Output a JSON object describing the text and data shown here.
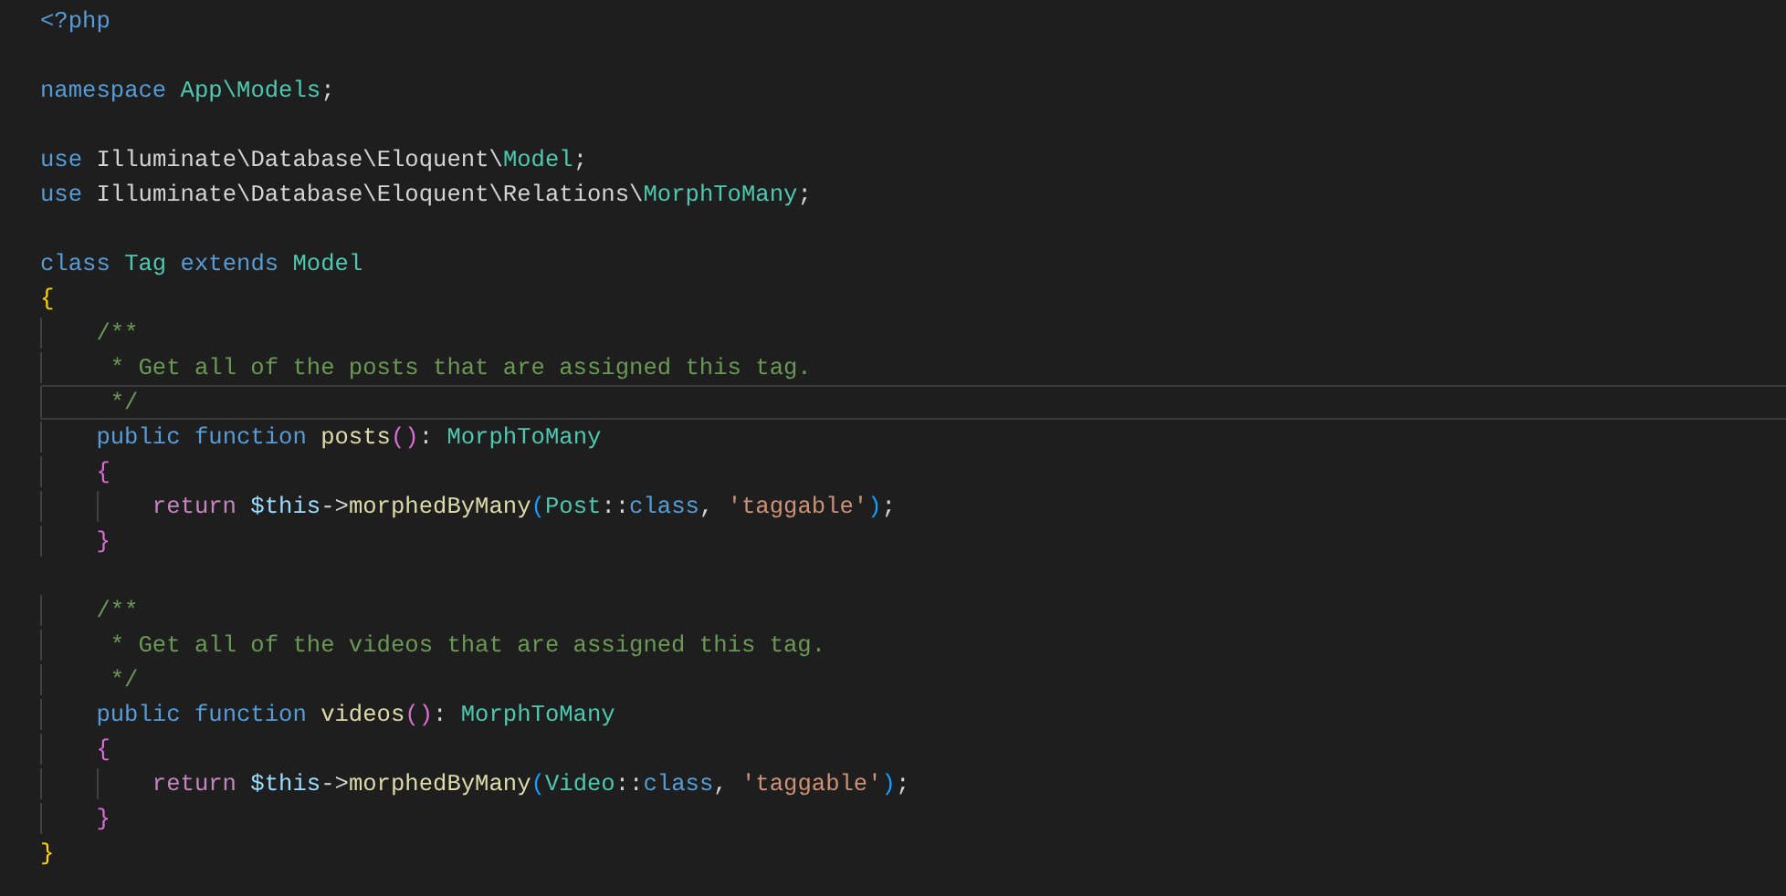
{
  "editor": {
    "lines": [
      {
        "current": false,
        "tokens": [
          {
            "kind": "keyword",
            "text": "<?php"
          }
        ]
      },
      {
        "current": false
      },
      {
        "current": false,
        "tokens": [
          {
            "kind": "keyword",
            "text": "namespace "
          },
          {
            "kind": "type",
            "text": "App\\Models"
          },
          {
            "kind": "plain",
            "text": ";"
          }
        ]
      },
      {
        "current": false
      },
      {
        "current": false,
        "tokens": [
          {
            "kind": "keyword",
            "text": "use"
          },
          {
            "kind": "plain",
            "text": " Illuminate\\Database\\Eloquent\\"
          },
          {
            "kind": "type",
            "text": "Model"
          },
          {
            "kind": "plain",
            "text": ";"
          }
        ]
      },
      {
        "current": false,
        "tokens": [
          {
            "kind": "keyword",
            "text": "use"
          },
          {
            "kind": "plain",
            "text": " Illuminate\\Database\\Eloquent\\Relations\\"
          },
          {
            "kind": "type",
            "text": "MorphToMany"
          },
          {
            "kind": "plain",
            "text": ";"
          }
        ]
      },
      {
        "current": false
      },
      {
        "current": false,
        "tokens": [
          {
            "kind": "keyword",
            "text": "class "
          },
          {
            "kind": "type",
            "text": "Tag "
          },
          {
            "kind": "keyword",
            "text": "extends "
          },
          {
            "kind": "type",
            "text": "Model"
          }
        ]
      },
      {
        "current": false,
        "tokens": [
          {
            "kind": "bracket1",
            "text": "{"
          }
        ]
      },
      {
        "current": false,
        "tokens": [
          {
            "kind": "comment",
            "text": "    /**"
          }
        ]
      },
      {
        "current": false,
        "tokens": [
          {
            "kind": "comment",
            "text": "     * Get all of the posts that are assigned this tag."
          }
        ]
      },
      {
        "current": true,
        "tokens": [
          {
            "kind": "comment",
            "text": "     */"
          }
        ]
      },
      {
        "current": false,
        "tokens": [
          {
            "kind": "keyword",
            "text": "    public function "
          },
          {
            "kind": "function",
            "text": "posts"
          },
          {
            "kind": "bracket2",
            "text": "()"
          },
          {
            "kind": "plain",
            "text": ": "
          },
          {
            "kind": "type",
            "text": "MorphToMany"
          }
        ]
      },
      {
        "current": false,
        "tokens": [
          {
            "kind": "bracket2",
            "text": "    {"
          }
        ]
      },
      {
        "current": false,
        "tokens": [
          {
            "kind": "control",
            "text": "        return "
          },
          {
            "kind": "variable",
            "text": "$this"
          },
          {
            "kind": "plain",
            "text": "->"
          },
          {
            "kind": "function",
            "text": "morphedByMany"
          },
          {
            "kind": "bracket3",
            "text": "("
          },
          {
            "kind": "type",
            "text": "Post"
          },
          {
            "kind": "plain",
            "text": "::"
          },
          {
            "kind": "keyword",
            "text": "class"
          },
          {
            "kind": "plain",
            "text": ", "
          },
          {
            "kind": "string",
            "text": "'taggable'"
          },
          {
            "kind": "bracket3",
            "text": ")"
          },
          {
            "kind": "plain",
            "text": ";"
          }
        ]
      },
      {
        "current": false,
        "tokens": [
          {
            "kind": "bracket2",
            "text": "    }"
          }
        ]
      },
      {
        "current": false
      },
      {
        "current": false,
        "tokens": [
          {
            "kind": "comment",
            "text": "    /**"
          }
        ]
      },
      {
        "current": false,
        "tokens": [
          {
            "kind": "comment",
            "text": "     * Get all of the videos that are assigned this tag."
          }
        ]
      },
      {
        "current": false,
        "tokens": [
          {
            "kind": "comment",
            "text": "     */"
          }
        ]
      },
      {
        "current": false,
        "tokens": [
          {
            "kind": "keyword",
            "text": "    public function "
          },
          {
            "kind": "function",
            "text": "videos"
          },
          {
            "kind": "bracket2",
            "text": "()"
          },
          {
            "kind": "plain",
            "text": ": "
          },
          {
            "kind": "type",
            "text": "MorphToMany"
          }
        ]
      },
      {
        "current": false,
        "tokens": [
          {
            "kind": "bracket2",
            "text": "    {"
          }
        ]
      },
      {
        "current": false,
        "tokens": [
          {
            "kind": "control",
            "text": "        return "
          },
          {
            "kind": "variable",
            "text": "$this"
          },
          {
            "kind": "plain",
            "text": "->"
          },
          {
            "kind": "function",
            "text": "morphedByMany"
          },
          {
            "kind": "bracket3",
            "text": "("
          },
          {
            "kind": "type",
            "text": "Video"
          },
          {
            "kind": "plain",
            "text": "::"
          },
          {
            "kind": "keyword",
            "text": "class"
          },
          {
            "kind": "plain",
            "text": ", "
          },
          {
            "kind": "string",
            "text": "'taggable'"
          },
          {
            "kind": "bracket3",
            "text": ")"
          },
          {
            "kind": "plain",
            "text": ";"
          }
        ]
      },
      {
        "current": false,
        "tokens": [
          {
            "kind": "bracket2",
            "text": "    }"
          }
        ]
      },
      {
        "current": false,
        "tokens": [
          {
            "kind": "bracket1",
            "text": "}"
          }
        ]
      }
    ]
  }
}
